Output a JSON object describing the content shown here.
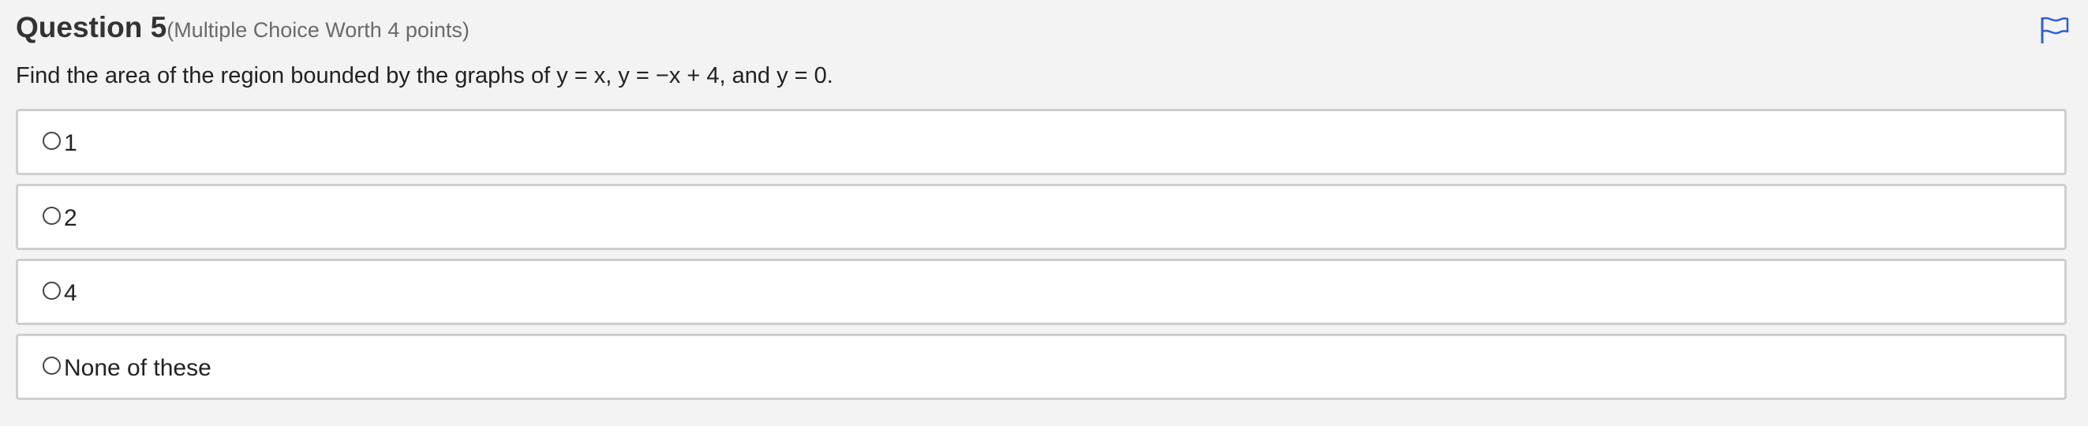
{
  "question": {
    "title": "Question 5",
    "meta": "(Multiple Choice Worth 4 points)",
    "prompt": "Find the area of the region bounded by the graphs of y = x, y = −x + 4, and y = 0.",
    "flag_icon": "flag-icon"
  },
  "choices": [
    {
      "label": "1"
    },
    {
      "label": "2"
    },
    {
      "label": "4"
    },
    {
      "label": "None of these"
    }
  ],
  "colors": {
    "background": "#f3f3f3",
    "flag": "#2f5fd0",
    "choice_border": "#cfcfcf"
  }
}
